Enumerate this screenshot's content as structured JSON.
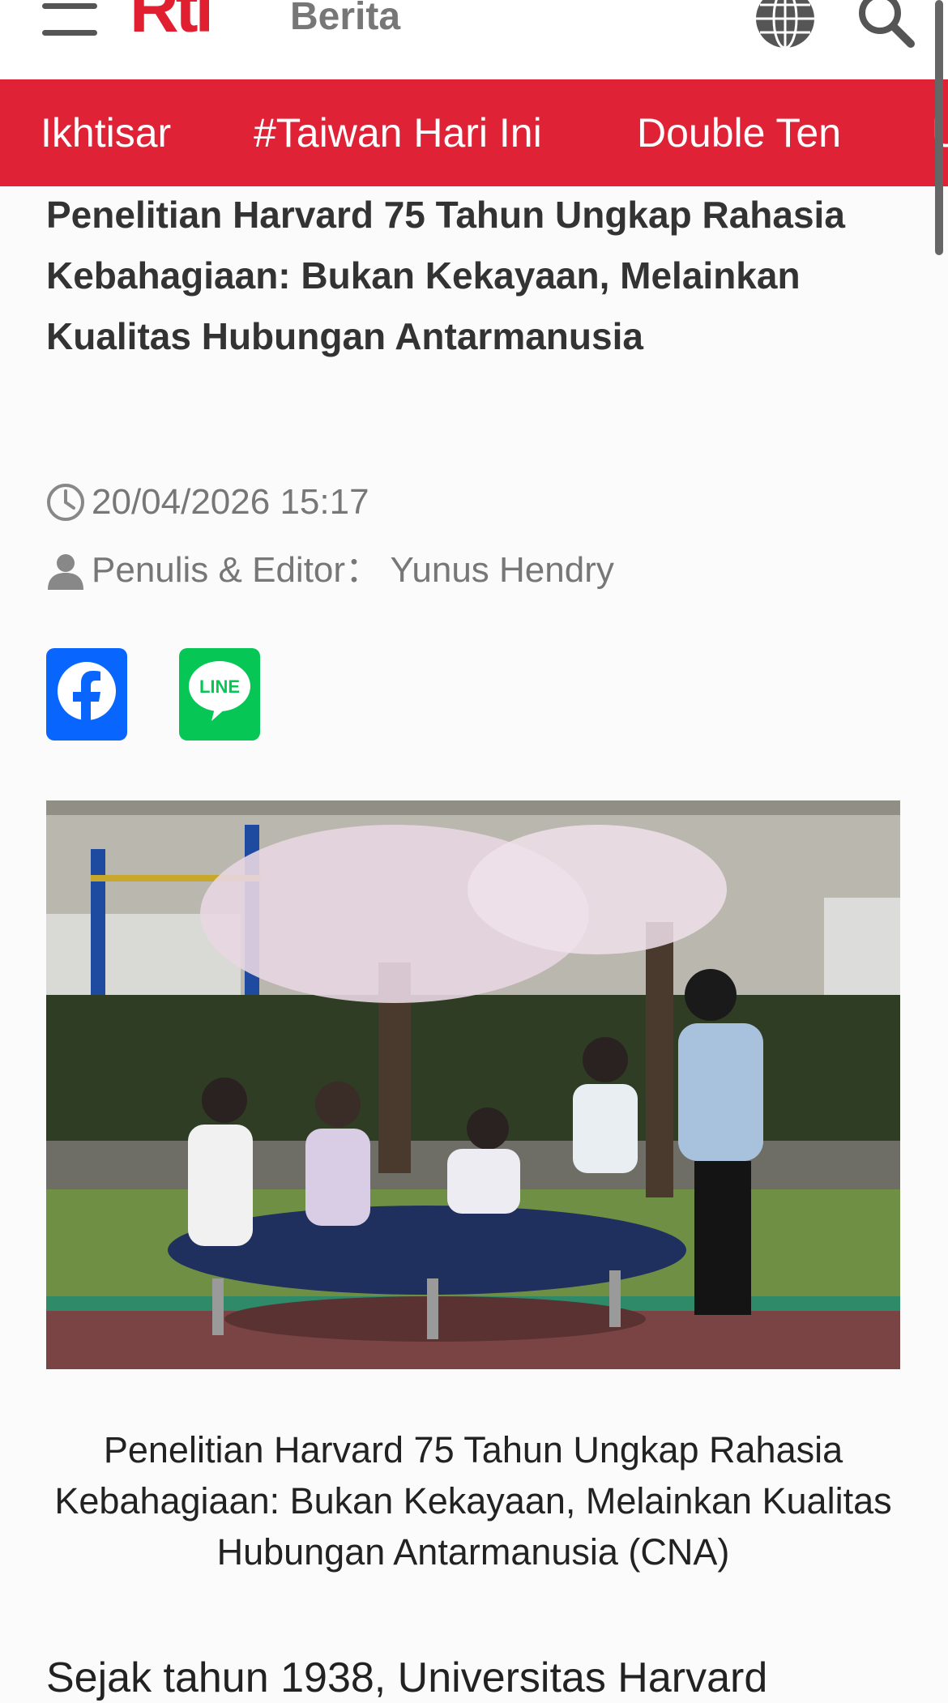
{
  "header": {
    "logo_text": "Rti",
    "section_title": "Berita",
    "icons": [
      "hamburger-menu-icon",
      "globe-icon",
      "search-icon"
    ],
    "accent_color": "#e02236"
  },
  "nav": {
    "items": [
      "Ikhtisar",
      "#Taiwan Hari Ini",
      "Double Ten",
      "U"
    ]
  },
  "article": {
    "title": "Penelitian Harvard 75 Tahun Ungkap Rahasia Kebahagiaan: Bukan Kekayaan, Melainkan Kualitas Hubungan Antarmanusia",
    "datetime": "20/04/2026 15:17",
    "author_line": "Penulis & Editor： Yunus Hendry",
    "share": {
      "facebook_color": "#0866ff",
      "line_color": "#06c755",
      "line_label": "LINE"
    },
    "photo_caption": "Penelitian Harvard 75 Tahun Ungkap Rahasia Kebahagiaan: Bukan Kekayaan, Melainkan Kualitas Hubungan Antarmanusia (CNA)",
    "body_start": "Sejak tahun 1938, Universitas Harvard"
  }
}
